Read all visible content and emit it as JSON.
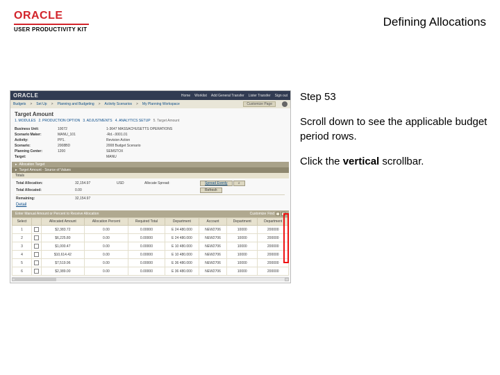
{
  "header": {
    "logo_brand": "ORACLE",
    "logo_sub": "USER PRODUCTIVITY KIT",
    "page_title": "Defining Allocations"
  },
  "instructions": {
    "step": "Step 53",
    "line1": "Scroll down to see the applicable budget period rows.",
    "line2a": "Click the ",
    "line2b_bold": "vertical",
    "line2c": " scrollbar."
  },
  "shot": {
    "topbar": {
      "brand": "ORACLE",
      "menu": [
        "Home",
        "Worklist",
        "Add General Transfer",
        "Lister Transfer",
        "Sign out"
      ]
    },
    "breadcrumb": {
      "items": [
        "Budgets",
        "Set Up",
        "Planning and Budgeting",
        "Activity Scenarios",
        "My Planning Workspace"
      ],
      "customize_btn": "Customize Page"
    },
    "section_title": "Target Amount",
    "trail_items": [
      "1. MODULES",
      "2. PRODUCTION OPTION",
      "3. ADJUSTMENTS",
      "4. ANALYTICS SETUP"
    ],
    "trail_current": "5. Target Amount",
    "kv": {
      "rows": [
        {
          "label": "Business Unit:",
          "v1": "10072",
          "v2": "1-3647 MASSACHUSETTS OPERATIONS"
        },
        {
          "label": "Scenario Maker:",
          "v1": "MANU_101",
          "v2": "-Rd.-.0001.01"
        },
        {
          "label": "Activity:",
          "v1": "PP1.",
          "v2": "Revision Action"
        },
        {
          "label": "Scenario:",
          "v1": "2008BD",
          "v2": "2008 Budget Scenario"
        },
        {
          "label": "Planning Center:",
          "v1": "1200",
          "v2": "SEMSTOX"
        },
        {
          "label": "Target:",
          "v1": "",
          "v2": "MANU"
        }
      ]
    },
    "bars": {
      "alloc_target": "Allocation Target",
      "source_values": "Target Amount - Source of Values",
      "totals_hdr": "Totals"
    },
    "totals": {
      "rows": [
        {
          "label": "Total Allocation:",
          "val": "32,154.97",
          "cur": "USD",
          "extra_label": "Allocate Spread:",
          "btn": "Spread Evenly"
        },
        {
          "label": "Total Allocated:",
          "val": "0.00",
          "cur": "",
          "extra_label": "",
          "btn": "Refresh"
        },
        {
          "label": "Remaining:",
          "val": "32,154.97",
          "cur": "",
          "extra_label": "",
          "btn": ""
        }
      ],
      "detail_link": "Detail"
    },
    "detail_header": {
      "title": "Enter Manual Amount or Percent to Receive Allocation",
      "customize": "Customize",
      "find": "Find"
    },
    "grid": {
      "columns": [
        "Select",
        "",
        "Allocated Amount",
        "Allocation Percent",
        "Required Total",
        "Department",
        "Account",
        "Department",
        "Department"
      ],
      "rows": [
        {
          "n": "1",
          "amt": "$2,383.72",
          "pct": "0.00",
          "req": "0.00000",
          "c1": "E 24 480.000",
          "c2": "NEW2706",
          "c3": "10000",
          "c4": "200000"
        },
        {
          "n": "2",
          "amt": "$6,225.80",
          "pct": "0.00",
          "req": "0.00000",
          "c1": "E 24 480.000",
          "c2": "NEW2706",
          "c3": "10000",
          "c4": "200000"
        },
        {
          "n": "3",
          "amt": "$1,000.47",
          "pct": "0.00",
          "req": "0.00000",
          "c1": "E 10 480.000",
          "c2": "NEW2706",
          "c3": "10000",
          "c4": "200000"
        },
        {
          "n": "4",
          "amt": "$10,614.42",
          "pct": "0.00",
          "req": "0.00000",
          "c1": "E 10 480.000",
          "c2": "NEW2706",
          "c3": "10000",
          "c4": "200000"
        },
        {
          "n": "5",
          "amt": "$7,519.96",
          "pct": "0.00",
          "req": "0.00000",
          "c1": "E 36 480.000",
          "c2": "NEW2706",
          "c3": "10000",
          "c4": "200000"
        },
        {
          "n": "6",
          "amt": "$2,389.00",
          "pct": "0.00",
          "req": "0.00000",
          "c1": "E 36 480.000",
          "c2": "NEW2706",
          "c3": "10000",
          "c4": "200000"
        }
      ]
    }
  }
}
